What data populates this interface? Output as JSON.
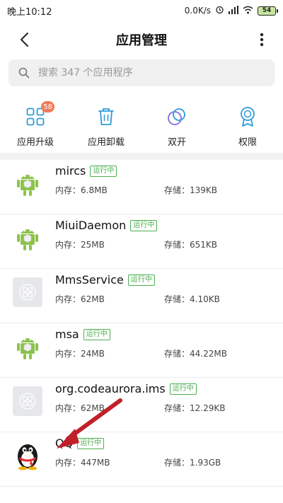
{
  "status_bar": {
    "time": "晚上10:12",
    "network_speed": "0.0K/s",
    "battery": "54"
  },
  "header": {
    "title": "应用管理"
  },
  "search": {
    "placeholder": "搜索 347 个应用程序"
  },
  "toolbar": [
    {
      "label": "应用升级",
      "badge": "58",
      "icon": "app-upgrade-icon"
    },
    {
      "label": "应用卸载",
      "icon": "trash-icon"
    },
    {
      "label": "双开",
      "icon": "dual-circles-icon"
    },
    {
      "label": "权限",
      "icon": "award-ribbon-icon"
    }
  ],
  "apps": [
    {
      "name": "mircs",
      "status": "运行中",
      "memory": "内存：6.8MB",
      "storage": "存储：139KB",
      "icon": "android-icon"
    },
    {
      "name": "MiuiDaemon",
      "status": "运行中",
      "memory": "内存：25MB",
      "storage": "存储：651KB",
      "icon": "android-icon"
    },
    {
      "name": "MmsService",
      "status": "运行中",
      "memory": "内存：62MB",
      "storage": "存储：4.10KB",
      "icon": "placeholder-app-icon"
    },
    {
      "name": "msa",
      "status": "运行中",
      "memory": "内存：24MB",
      "storage": "存储：44.22MB",
      "icon": "android-icon"
    },
    {
      "name": "org.codeaurora.ims",
      "status": "运行中",
      "memory": "内存：62MB",
      "storage": "存储：12.29KB",
      "icon": "placeholder-app-icon"
    },
    {
      "name": "QQ",
      "status": "运行中",
      "memory": "内存：447MB",
      "storage": "存储：1.93GB",
      "icon": "qq-penguin-icon"
    }
  ],
  "colors": {
    "accent": "#2f9bd6",
    "running": "#4caf50",
    "badge": "#f07a5a",
    "annotation_arrow": "#c0202a"
  }
}
